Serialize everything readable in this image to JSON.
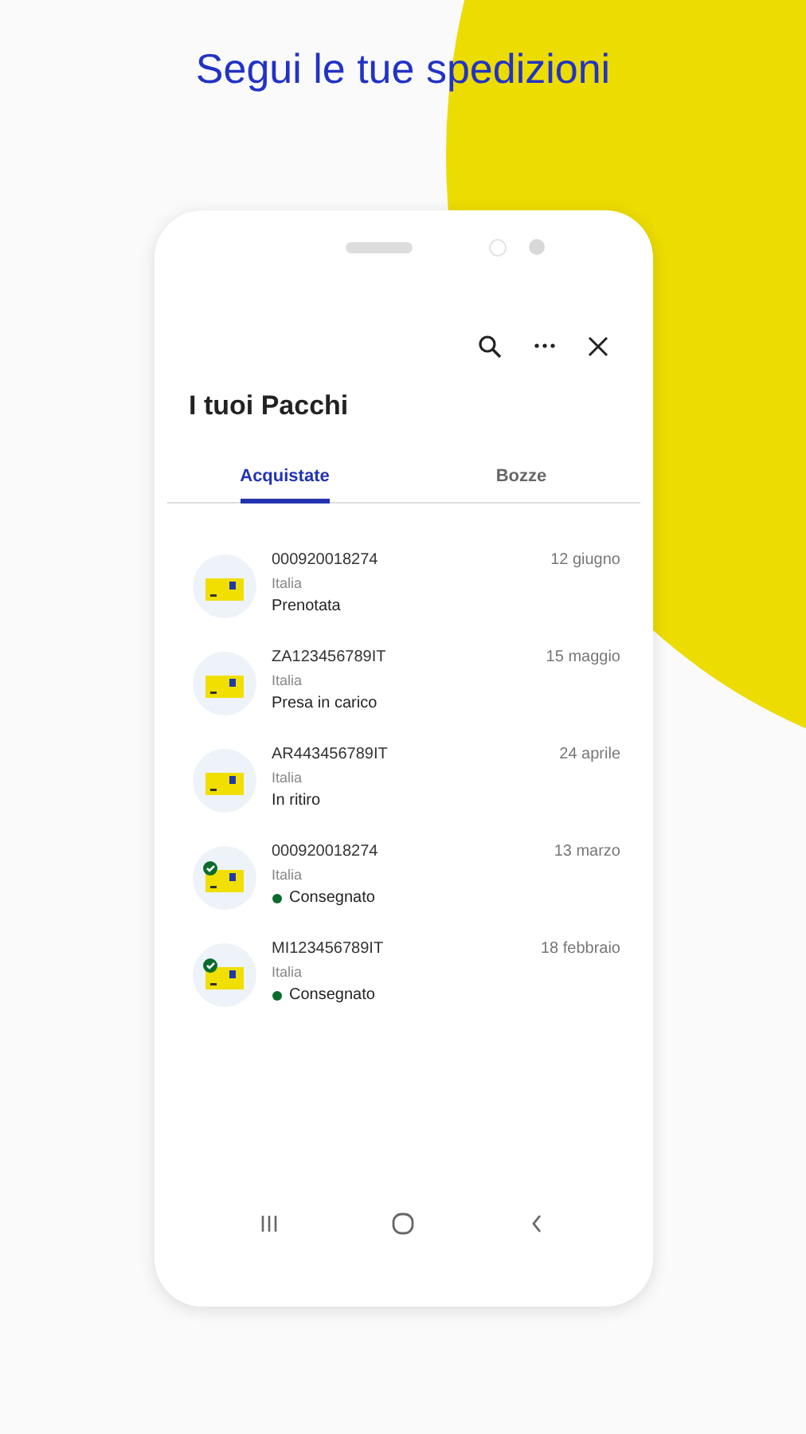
{
  "headline": "Segui le tue spedizioni",
  "screen": {
    "title": "I tuoi Pacchi",
    "tabs": [
      {
        "label": "Acquistate",
        "selected": true
      },
      {
        "label": "Bozze",
        "selected": false
      }
    ],
    "shipments": [
      {
        "code": "000920018274",
        "date": "12 giugno",
        "country": "Italia",
        "status": "Prenotata",
        "delivered": false
      },
      {
        "code": "ZA123456789IT",
        "date": "15 maggio",
        "country": "Italia",
        "status": "Presa in carico",
        "delivered": false
      },
      {
        "code": "AR443456789IT",
        "date": "24 aprile",
        "country": "Italia",
        "status": "In ritiro",
        "delivered": false
      },
      {
        "code": "000920018274",
        "date": "13 marzo",
        "country": "Italia",
        "status": "Consegnato",
        "delivered": true
      },
      {
        "code": "MI123456789IT",
        "date": "18 febbraio",
        "country": "Italia",
        "status": "Consegnato",
        "delivered": true
      }
    ]
  }
}
